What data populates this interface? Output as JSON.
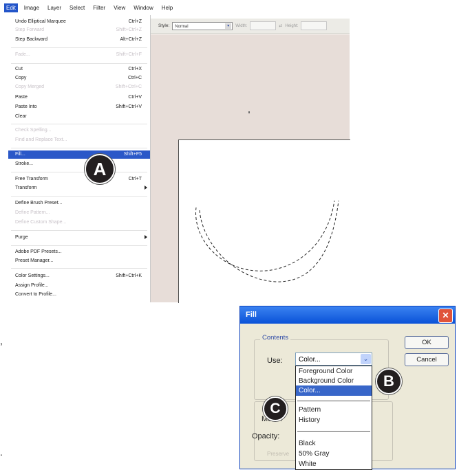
{
  "menubar": {
    "items": [
      "Edit",
      "Image",
      "Layer",
      "Select",
      "Filter",
      "View",
      "Window",
      "Help"
    ]
  },
  "options_bar": {
    "style_label": "Style:",
    "style_value": "Normal",
    "width_label": "Width:",
    "height_label": "Height:"
  },
  "edit_menu": {
    "undo": {
      "label": "Undo Elliptical Marquee",
      "shortcut": "Ctrl+Z"
    },
    "step_forward": {
      "label": "Step Forward",
      "shortcut": "Shift+Ctrl+Z"
    },
    "step_backward": {
      "label": "Step Backward",
      "shortcut": "Alt+Ctrl+Z"
    },
    "fade": {
      "label": "Fade...",
      "shortcut": "Shift+Ctrl+F"
    },
    "cut": {
      "label": "Cut",
      "shortcut": "Ctrl+X"
    },
    "copy": {
      "label": "Copy",
      "shortcut": "Ctrl+C"
    },
    "copy_merged": {
      "label": "Copy Merged",
      "shortcut": "Shift+Ctrl+C"
    },
    "paste": {
      "label": "Paste",
      "shortcut": "Ctrl+V"
    },
    "paste_into": {
      "label": "Paste Into",
      "shortcut": "Shift+Ctrl+V"
    },
    "clear": {
      "label": "Clear"
    },
    "check_spelling": {
      "label": "Check Spelling..."
    },
    "find_replace": {
      "label": "Find and Replace Text..."
    },
    "fill": {
      "label": "Fill...",
      "shortcut": "Shift+F5"
    },
    "stroke": {
      "label": "Stroke..."
    },
    "free_transform": {
      "label": "Free Transform",
      "shortcut": "Ctrl+T"
    },
    "transform": {
      "label": "Transform"
    },
    "define_brush": {
      "label": "Define Brush Preset..."
    },
    "define_pattern": {
      "label": "Define Pattern..."
    },
    "define_custom_shape": {
      "label": "Define Custom Shape..."
    },
    "purge": {
      "label": "Purge"
    },
    "pdf_presets": {
      "label": "Adobe PDF Presets..."
    },
    "preset_manager": {
      "label": "Preset Manager..."
    },
    "color_settings": {
      "label": "Color Settings...",
      "shortcut": "Shift+Ctrl+K"
    },
    "assign_profile": {
      "label": "Assign Profile..."
    },
    "convert_profile": {
      "label": "Convert to Profile..."
    }
  },
  "callouts": {
    "a": "A",
    "b": "B",
    "c": "C"
  },
  "fill_dialog": {
    "title": "Fill",
    "close_glyph": "✕",
    "contents_label": "Contents",
    "use_label": "Use:",
    "use_value": "Color...",
    "use_arrow": "⌄",
    "ok": "OK",
    "cancel": "Cancel",
    "use_options": [
      "Foreground Color",
      "Background Color",
      "Color...",
      "Pattern",
      "History",
      "Black",
      "50% Gray",
      "White"
    ],
    "selected_option": "Color...",
    "mode_label": "Mode:",
    "opacity_label": "Opacity:",
    "preserve_label": "Preserve"
  },
  "stray_text": {
    "comma": ",",
    "dot": "."
  },
  "colors": {
    "menu_highlight": "#2b58c8",
    "workspace": "#e7ddd8",
    "dialog_bg": "#ece9d8",
    "dialog_title": "#0a52d8"
  },
  "icons": [
    "chevron-down-icon",
    "close-icon",
    "submenu-arrow-icon"
  ]
}
